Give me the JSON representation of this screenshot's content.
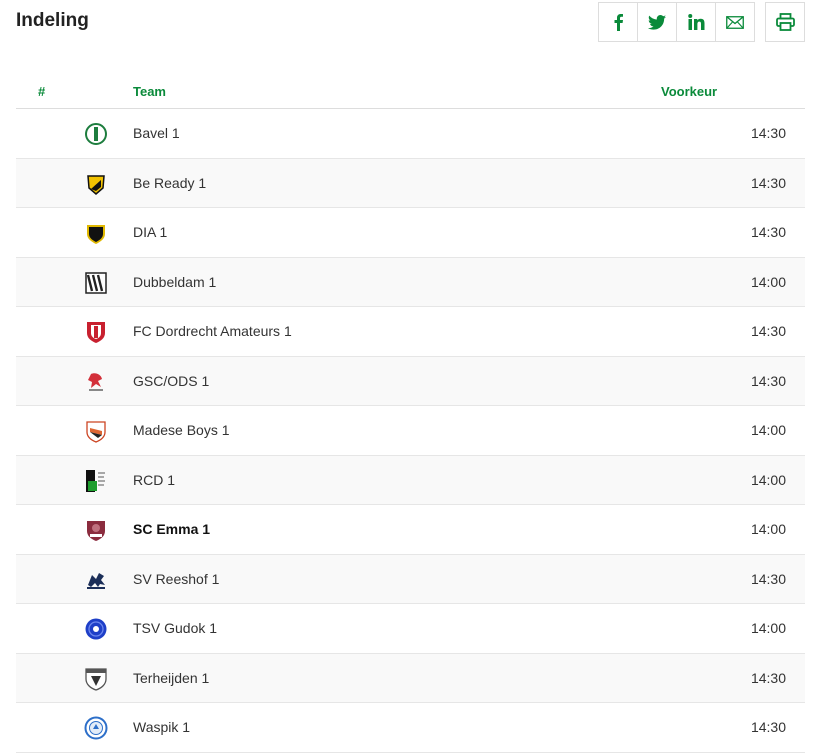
{
  "header": {
    "title": "Indeling"
  },
  "share": {
    "facebook_icon": "facebook-icon",
    "twitter_icon": "twitter-icon",
    "linkedin_icon": "linkedin-icon",
    "email_icon": "email-icon",
    "print_icon": "print-icon",
    "accent": "#0a8a3a"
  },
  "table": {
    "columns": {
      "number": "#",
      "team": "Team",
      "preference": "Voorkeur"
    },
    "rows": [
      {
        "team": "Bavel 1",
        "time": "14:30",
        "logo": "bavel-logo"
      },
      {
        "team": "Be Ready 1",
        "time": "14:30",
        "logo": "be-ready-logo"
      },
      {
        "team": "DIA 1",
        "time": "14:30",
        "logo": "dia-logo"
      },
      {
        "team": "Dubbeldam 1",
        "time": "14:00",
        "logo": "dubbeldam-logo"
      },
      {
        "team": "FC Dordrecht Amateurs 1",
        "time": "14:30",
        "logo": "fc-dordrecht-logo"
      },
      {
        "team": "GSC/ODS 1",
        "time": "14:30",
        "logo": "gsc-ods-logo"
      },
      {
        "team": "Madese Boys 1",
        "time": "14:00",
        "logo": "madese-boys-logo"
      },
      {
        "team": "RCD 1",
        "time": "14:00",
        "logo": "rcd-logo"
      },
      {
        "team": "SC Emma 1",
        "time": "14:00",
        "logo": "sc-emma-logo",
        "highlight": true
      },
      {
        "team": "SV Reeshof 1",
        "time": "14:30",
        "logo": "sv-reeshof-logo"
      },
      {
        "team": "TSV Gudok 1",
        "time": "14:00",
        "logo": "tsv-gudok-logo"
      },
      {
        "team": "Terheijden 1",
        "time": "14:30",
        "logo": "terheijden-logo"
      },
      {
        "team": "Waspik 1",
        "time": "14:30",
        "logo": "waspik-logo"
      }
    ]
  }
}
